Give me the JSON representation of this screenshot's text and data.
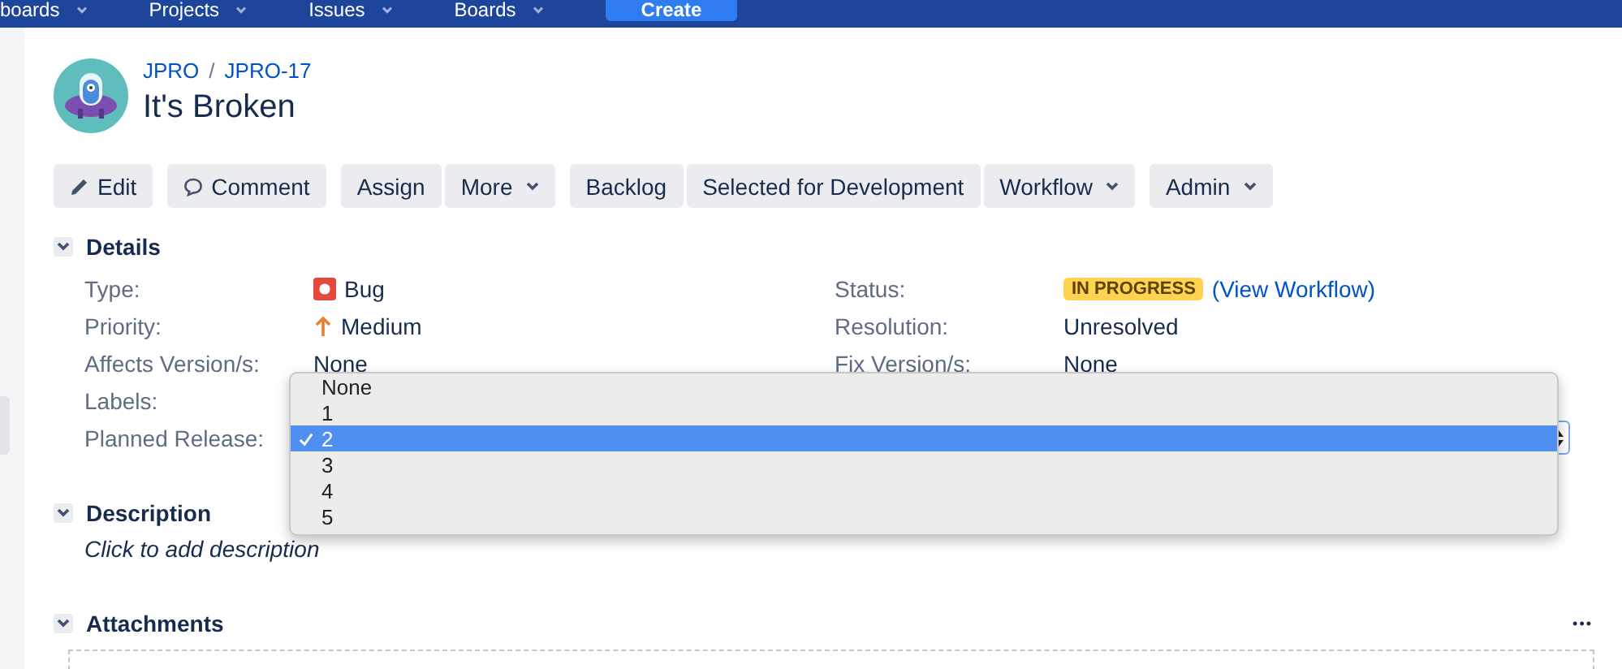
{
  "nav": {
    "items": [
      {
        "label": "boards",
        "caret": true
      },
      {
        "label": "Projects",
        "caret": true
      },
      {
        "label": "Issues",
        "caret": true
      },
      {
        "label": "Boards",
        "caret": true
      }
    ],
    "create": "Create"
  },
  "breadcrumbs": {
    "separator": "/",
    "items": [
      "JPRO",
      "JPRO-17"
    ]
  },
  "title": "It's Broken",
  "toolbar": [
    [
      {
        "label": "Edit",
        "kind": "edit",
        "caret": false
      }
    ],
    [
      {
        "label": "Comment",
        "kind": "comment",
        "caret": false
      }
    ],
    [
      {
        "label": "Assign",
        "kind": "plain",
        "caret": false
      },
      {
        "label": "More",
        "kind": "plain",
        "caret": true
      }
    ],
    [
      {
        "label": "Backlog",
        "kind": "plain",
        "caret": false
      },
      {
        "label": "Selected for Development",
        "kind": "plain",
        "caret": false
      },
      {
        "label": "Workflow",
        "kind": "plain",
        "caret": true
      }
    ],
    [
      {
        "label": "Admin",
        "kind": "plain",
        "caret": true
      }
    ]
  ],
  "details": {
    "title": "Details",
    "expanded": true,
    "left": [
      {
        "label": "Type:",
        "kind": "bug",
        "value": "Bug"
      },
      {
        "label": "Priority:",
        "kind": "priority",
        "value": "Medium"
      },
      {
        "label": "Affects Version/s:",
        "kind": "text",
        "value": "None"
      },
      {
        "label": "Labels:",
        "kind": "empty"
      }
    ],
    "right": [
      {
        "label": "Status:",
        "kind": "status",
        "value": "IN PROGRESS",
        "link": "(View Workflow)"
      },
      {
        "label": "Resolution:",
        "kind": "text",
        "value": "Unresolved"
      },
      {
        "label": "Fix Version/s:",
        "kind": "text",
        "value": "None"
      }
    ],
    "planned": {
      "label": "Planned Release:"
    }
  },
  "dropdown": [
    {
      "label": "None",
      "selected": false
    },
    {
      "label": "1",
      "selected": false
    },
    {
      "label": "2",
      "selected": true
    },
    {
      "label": "3",
      "selected": false
    },
    {
      "label": "4",
      "selected": false
    },
    {
      "label": "5",
      "selected": false
    }
  ],
  "description": {
    "title": "Description",
    "expanded": true,
    "placeholder": "Click to add description"
  },
  "attachments": {
    "title": "Attachments",
    "expanded": true,
    "menu": "•••"
  }
}
